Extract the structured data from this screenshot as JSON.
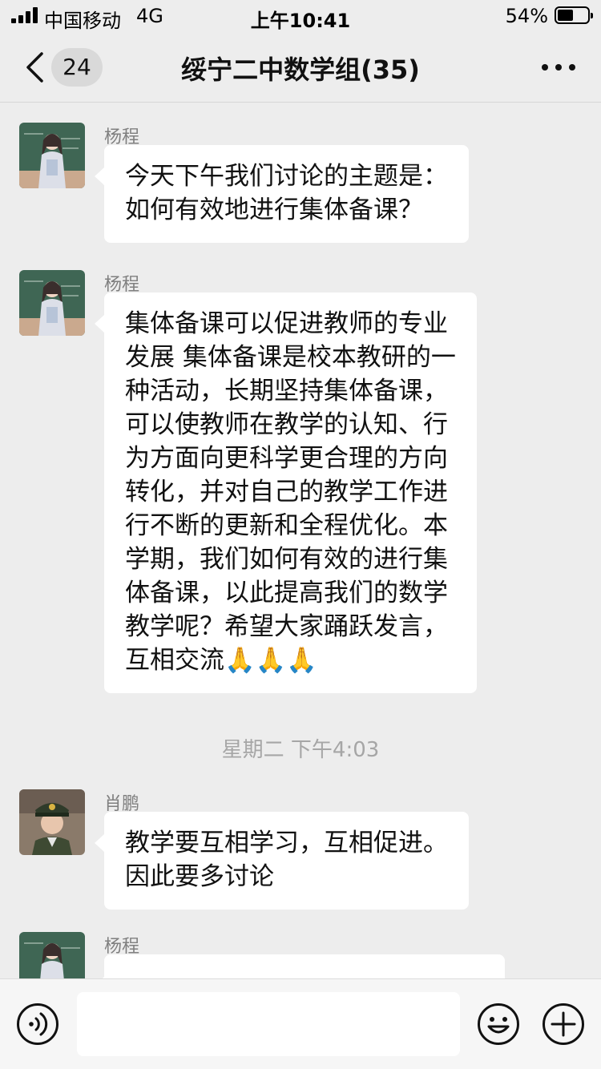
{
  "status_bar": {
    "carrier": "中国移动",
    "network": "4G",
    "time": "上午10:41",
    "battery_percent": "54%",
    "battery_level": 0.54
  },
  "nav": {
    "unread_count": "24",
    "title": "绥宁二中数学组(35)",
    "back_icon": "chevron-left-icon",
    "more_icon": "more-dots-icon"
  },
  "messages": [
    {
      "sender": "杨程",
      "text": "今天下午我们讨论的主题是：\n如何有效地进行集体备课？"
    },
    {
      "sender": "杨程",
      "text": "集体备课可以促进教师的专业\n发展 集体备课是校本教研的一\n种活动，长期坚持集体备课，\n可以使教师在教学的认知、行\n为方面向更科学更合理的方向\n转化，并对自己的教学工作进\n行不断的更新和全程优化。本\n学期，我们如何有效的进行集\n体备课，以此提高我们的数学\n教学呢？希望大家踊跃发言，\n互相交流🙏🙏🙏"
    },
    {
      "sender": "肖鹏",
      "text": "教学要互相学习，互相促进。\n因此要多讨论"
    },
    {
      "sender": "杨程",
      "text": ""
    }
  ],
  "timestamp": "星期二 下午4:03",
  "input_bar": {
    "input_value": "",
    "voice_icon": "voice-icon",
    "emoji_icon": "emoji-icon",
    "plus_icon": "plus-icon"
  },
  "colors": {
    "background": "#ededed",
    "bubble": "#ffffff",
    "sender_name": "#7f7f7f",
    "timestamp": "#a6a6a6"
  }
}
